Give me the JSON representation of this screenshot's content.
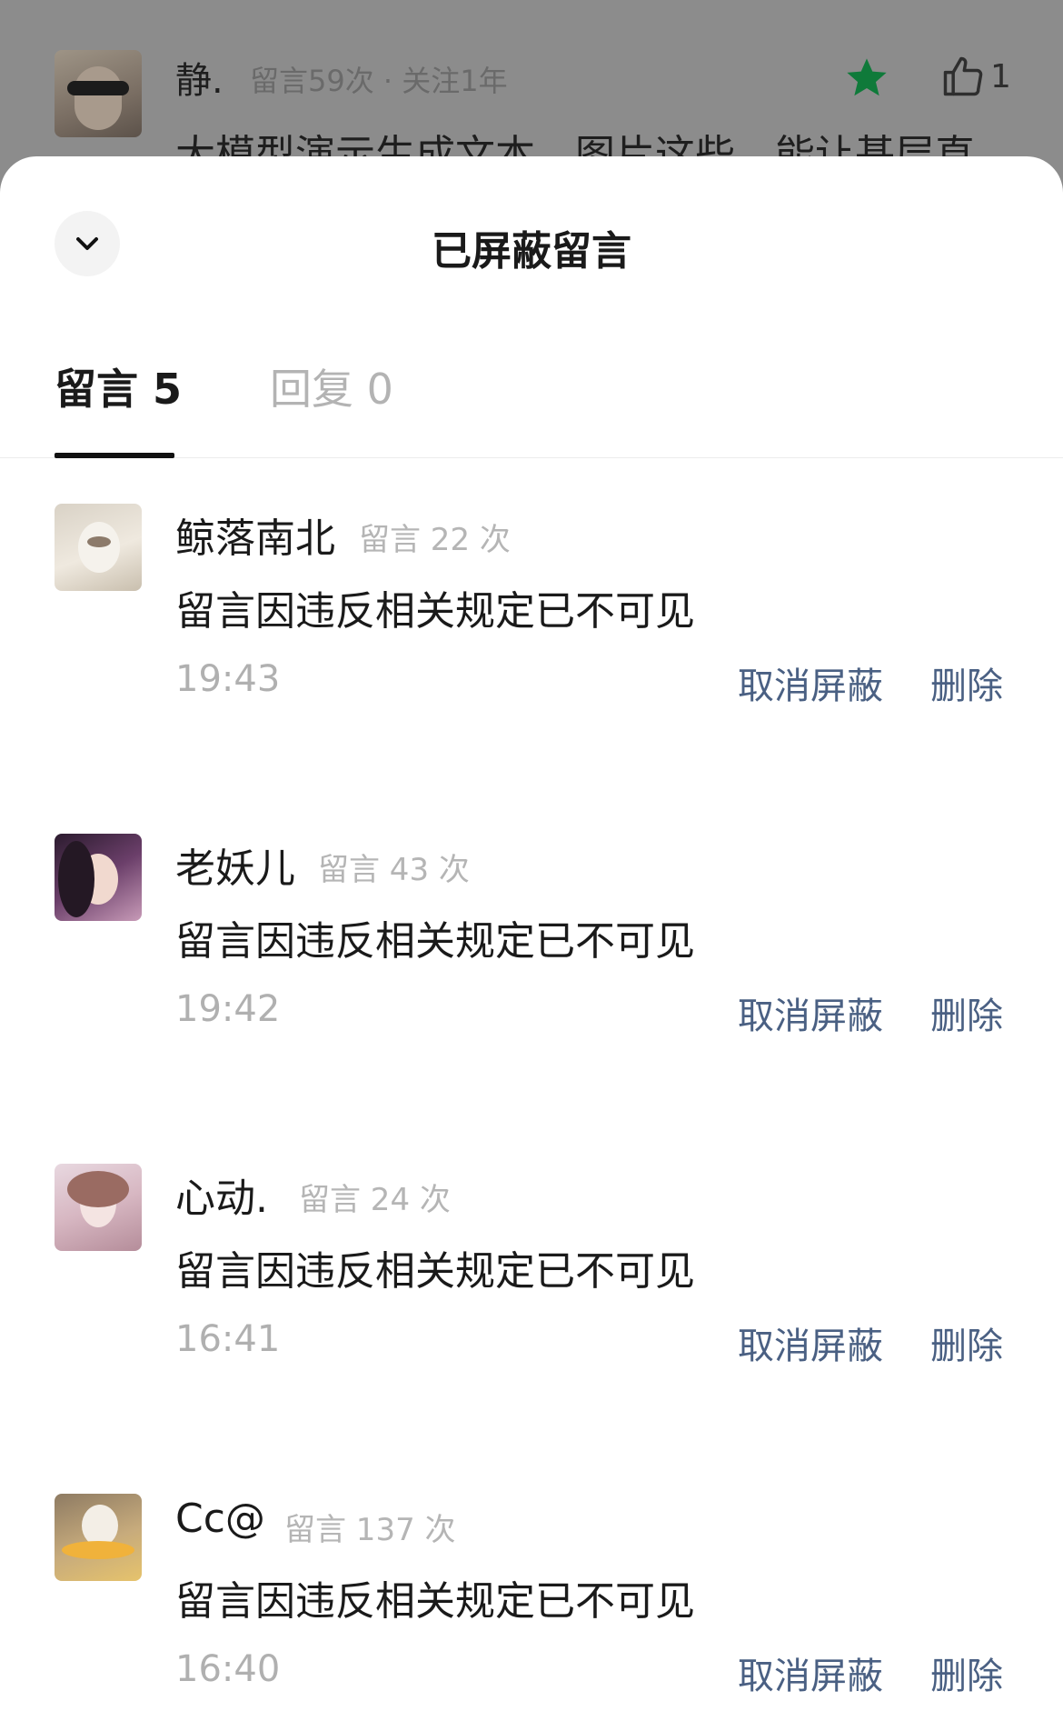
{
  "background_comment": {
    "name": "静.",
    "meta": "留言59次 · 关注1年",
    "like_count": "1",
    "text": "大模型演示生成文本、图片这些，能让基层直"
  },
  "sheet": {
    "title": "已屏蔽留言",
    "tabs": [
      {
        "label": "留言 5"
      },
      {
        "label": "回复 0"
      }
    ]
  },
  "comments": [
    {
      "name": "鲸落南北",
      "meta": "留言 22 次",
      "content": "留言因违反相关规定已不可见",
      "time": "19:43",
      "unblock": "取消屏蔽",
      "delete": "删除"
    },
    {
      "name": "老妖儿",
      "meta": "留言 43 次",
      "content": "留言因违反相关规定已不可见",
      "time": "19:42",
      "unblock": "取消屏蔽",
      "delete": "删除"
    },
    {
      "name": "心动.",
      "meta": "留言 24 次",
      "content": "留言因违反相关规定已不可见",
      "time": "16:41",
      "unblock": "取消屏蔽",
      "delete": "删除"
    },
    {
      "name": "Cc@",
      "meta": "留言 137 次",
      "content": "留言因违反相关规定已不可见",
      "time": "16:40",
      "unblock": "取消屏蔽",
      "delete": "删除"
    }
  ],
  "colors": {
    "action": "#4a6083",
    "star": "#0f7a3a"
  }
}
